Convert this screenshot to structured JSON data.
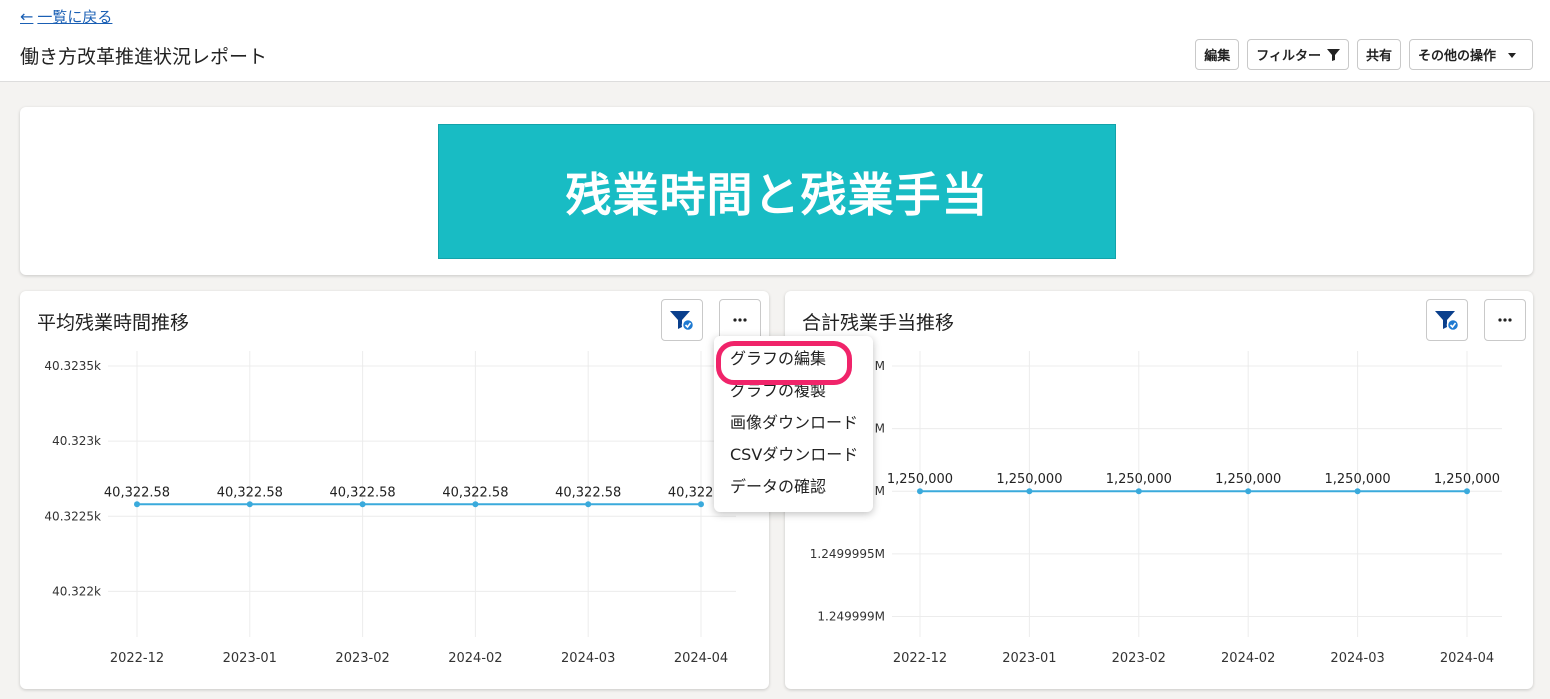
{
  "header": {
    "back_label": "一覧に戻る",
    "title": "働き方改革推進状況レポート",
    "toolbar": {
      "edit": "編集",
      "filter": "フィルター",
      "share": "共有",
      "more": "その他の操作"
    }
  },
  "banner": {
    "text": "残業時間と残業手当"
  },
  "colors": {
    "accent": "#18bcc4",
    "line": "#3aaadc",
    "highlight": "#f0246a",
    "link": "#1a5fb4"
  },
  "menu": {
    "items": [
      "グラフの編集",
      "グラフの複製",
      "画像ダウンロード",
      "CSVダウンロード",
      "データの確認"
    ],
    "highlighted_index": 0
  },
  "chart_data": [
    {
      "type": "line",
      "title": "平均残業時間推移",
      "categories": [
        "2022-12",
        "2023-01",
        "2023-02",
        "2024-02",
        "2024-03",
        "2024-04"
      ],
      "values": [
        40322.58,
        40322.58,
        40322.58,
        40322.58,
        40322.58,
        40322.58
      ],
      "value_labels": [
        "40,322.58",
        "40,322.58",
        "40,322.58",
        "40,322.58",
        "40,322.58",
        "40,322.58"
      ],
      "yticks": [
        40323.5,
        40323,
        40322.5,
        40322
      ],
      "ytick_labels": [
        "40.3235k",
        "40.323k",
        "40.3225k",
        "40.322k"
      ],
      "ylim": [
        40321.75,
        40323.5
      ],
      "grid": true
    },
    {
      "type": "line",
      "title": "合計残業手当推移",
      "categories": [
        "2022-12",
        "2023-01",
        "2023-02",
        "2024-02",
        "2024-03",
        "2024-04"
      ],
      "values": [
        1250000,
        1250000,
        1250000,
        1250000,
        1250000,
        1250000
      ],
      "value_labels": [
        "1,250,000",
        "1,250,000",
        "1,250,000",
        "1,250,000",
        "1,250,000",
        "1,250,000"
      ],
      "yticks": [
        1250001,
        1250000.5,
        1250000,
        1249999.5,
        1249999
      ],
      "ytick_labels": [
        "M",
        "M",
        "M",
        "1.2499995M",
        "1.249999M"
      ],
      "ylim": [
        1249998.9,
        1250001
      ],
      "grid": true
    }
  ]
}
